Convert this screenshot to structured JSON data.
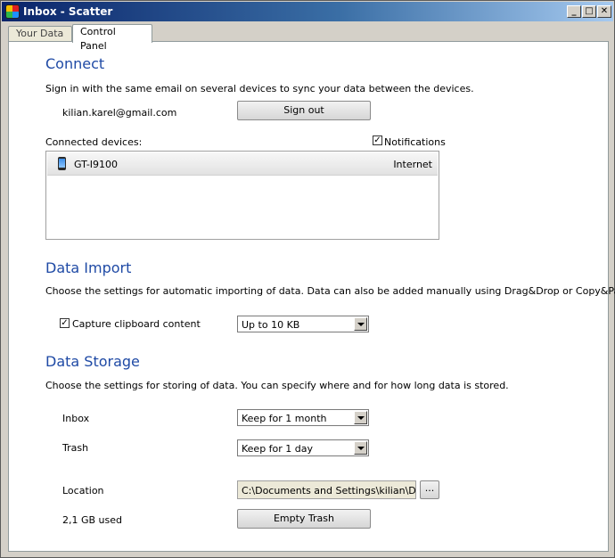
{
  "window": {
    "title": "Inbox - Scatter",
    "minimize_glyph": "_",
    "maximize_glyph": "□",
    "close_glyph": "✕"
  },
  "tabs": [
    {
      "label": "Your Data",
      "active": false
    },
    {
      "label": "Control Panel",
      "active": true
    }
  ],
  "connect": {
    "heading": "Connect",
    "description": "Sign in with the same email on several devices to sync your data between the devices.",
    "email": "kilian.karel@gmail.com",
    "sign_out_label": "Sign out",
    "devices_label": "Connected devices:",
    "notifications_label": "Notifications",
    "notifications_checked": true,
    "devices": [
      {
        "name": "GT-I9100",
        "connection": "Internet",
        "icon": "phone-icon"
      }
    ]
  },
  "data_import": {
    "heading": "Data Import",
    "description": "Choose the settings for automatic importing of data. Data can also be added manually using Drag&Drop or Copy&Paste.",
    "capture_label": "Capture clipboard content",
    "capture_checked": true,
    "capture_limit": "Up to 10 KB"
  },
  "data_storage": {
    "heading": "Data Storage",
    "description": "Choose the settings for storing of data. You can specify where and for how long data is stored.",
    "inbox_label": "Inbox",
    "inbox_value": "Keep for 1 month",
    "trash_label": "Trash",
    "trash_value": "Keep for 1 day",
    "location_label": "Location",
    "location_value": "C:\\Documents and Settings\\kilian\\Dokum",
    "browse_label": "...",
    "usage": "2,1 GB used",
    "empty_trash_label": "Empty Trash"
  },
  "check_glyph": "✓"
}
